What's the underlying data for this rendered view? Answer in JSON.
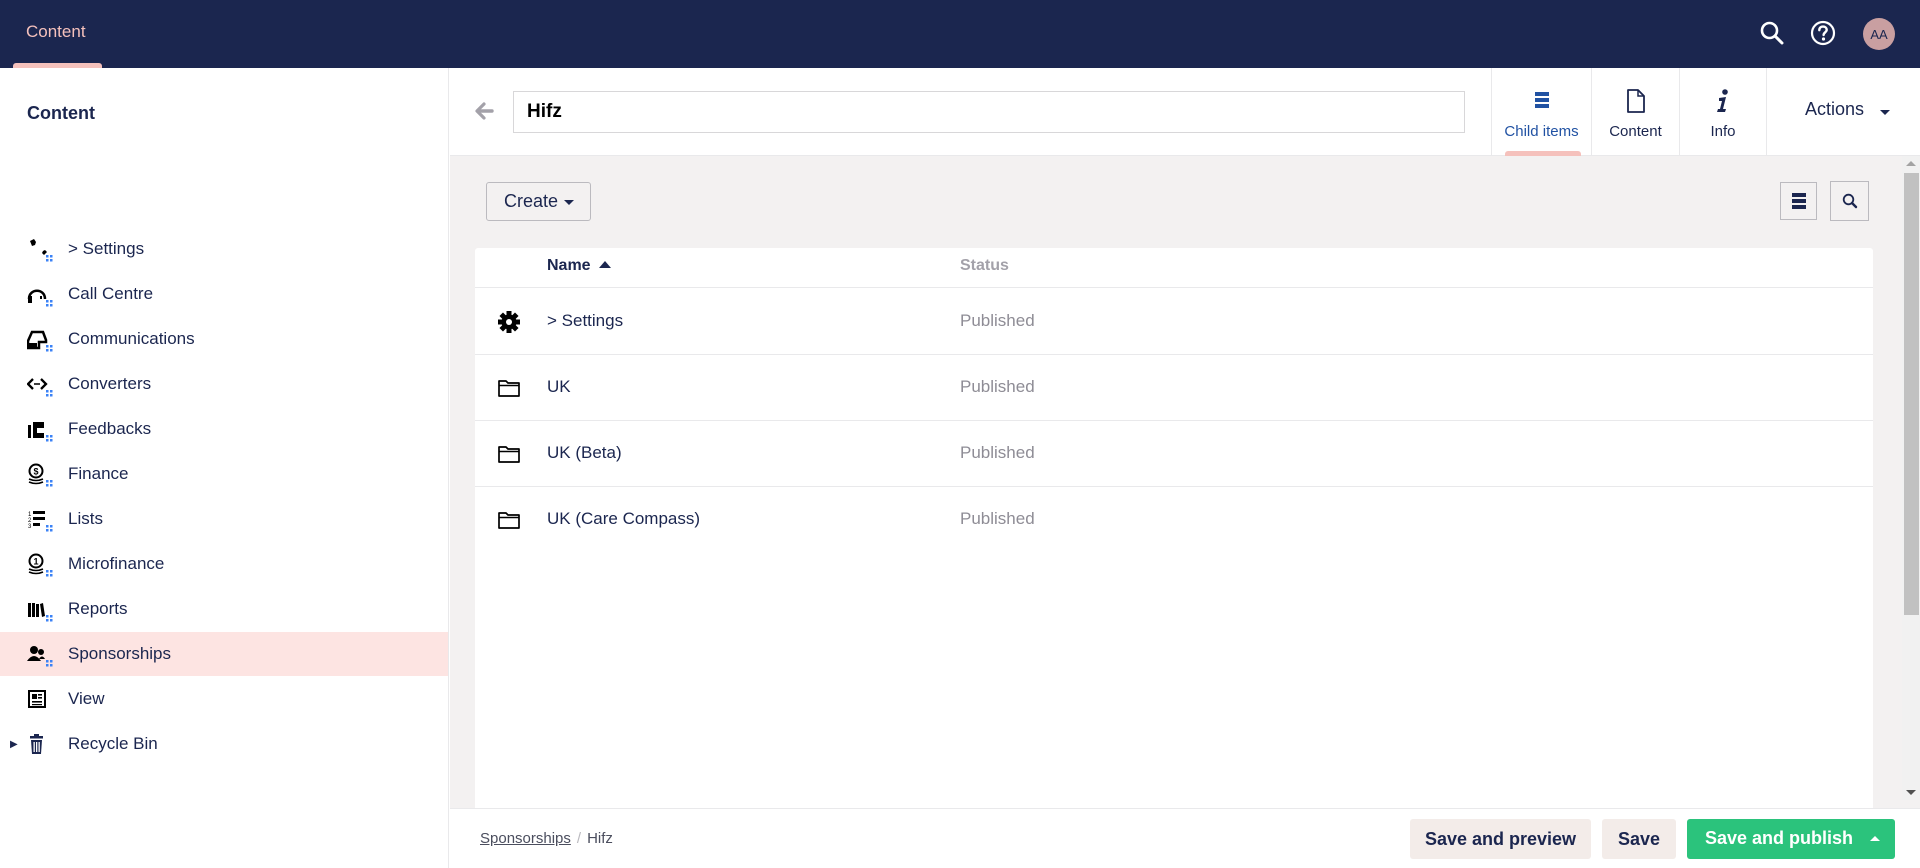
{
  "topbar": {
    "section_tab": "Content",
    "search_icon": "search-icon",
    "help_icon": "help-icon",
    "avatar_initials": "AA"
  },
  "sidebar": {
    "title": "Content",
    "items": [
      {
        "label": "> Settings",
        "icon": "wrench-icon",
        "active": false,
        "has_children": false
      },
      {
        "label": "Call Centre",
        "icon": "headset-icon",
        "active": false,
        "has_children": false
      },
      {
        "label": "Communications",
        "icon": "inbox-icon",
        "active": false,
        "has_children": false
      },
      {
        "label": "Converters",
        "icon": "code-arrows-icon",
        "active": false,
        "has_children": false
      },
      {
        "label": "Feedbacks",
        "icon": "feedback-icon",
        "active": false,
        "has_children": false
      },
      {
        "label": "Finance",
        "icon": "coins-icon",
        "active": false,
        "has_children": false
      },
      {
        "label": "Lists",
        "icon": "ordered-list-icon",
        "active": false,
        "has_children": false
      },
      {
        "label": "Microfinance",
        "icon": "coin-stack-icon",
        "active": false,
        "has_children": false
      },
      {
        "label": "Reports",
        "icon": "books-icon",
        "active": false,
        "has_children": false
      },
      {
        "label": "Sponsorships",
        "icon": "users-icon",
        "active": true,
        "has_children": false
      },
      {
        "label": "View",
        "icon": "newspaper-icon",
        "active": false,
        "has_children": false
      },
      {
        "label": "Recycle Bin",
        "icon": "trash-icon",
        "active": false,
        "has_children": true
      }
    ]
  },
  "editor": {
    "name_value": "Hifz",
    "tabs": [
      {
        "label": "Child items",
        "icon": "list-icon",
        "active": true
      },
      {
        "label": "Content",
        "icon": "document-icon",
        "active": false
      },
      {
        "label": "Info",
        "icon": "info-icon",
        "active": false
      }
    ],
    "actions_label": "Actions"
  },
  "listview": {
    "create_label": "Create",
    "columns": {
      "name": "Name",
      "status": "Status"
    },
    "sort": "ascending",
    "rows": [
      {
        "name": "> Settings",
        "status": "Published",
        "icon": "gear-icon"
      },
      {
        "name": "UK",
        "status": "Published",
        "icon": "folder-icon"
      },
      {
        "name": "UK (Beta)",
        "status": "Published",
        "icon": "folder-icon"
      },
      {
        "name": "UK (Care Compass)",
        "status": "Published",
        "icon": "folder-icon"
      }
    ]
  },
  "footer": {
    "breadcrumb": [
      {
        "label": "Sponsorships",
        "link": true
      },
      {
        "label": "Hifz",
        "link": false
      }
    ],
    "save_preview_label": "Save and preview",
    "save_label": "Save",
    "save_publish_label": "Save and publish"
  },
  "colors": {
    "topbar": "#1b264f",
    "accent": "#f5c1bc",
    "active_item_bg": "#fde4e2",
    "publish": "#2bc37c",
    "active_tab_text": "#2152a3"
  }
}
